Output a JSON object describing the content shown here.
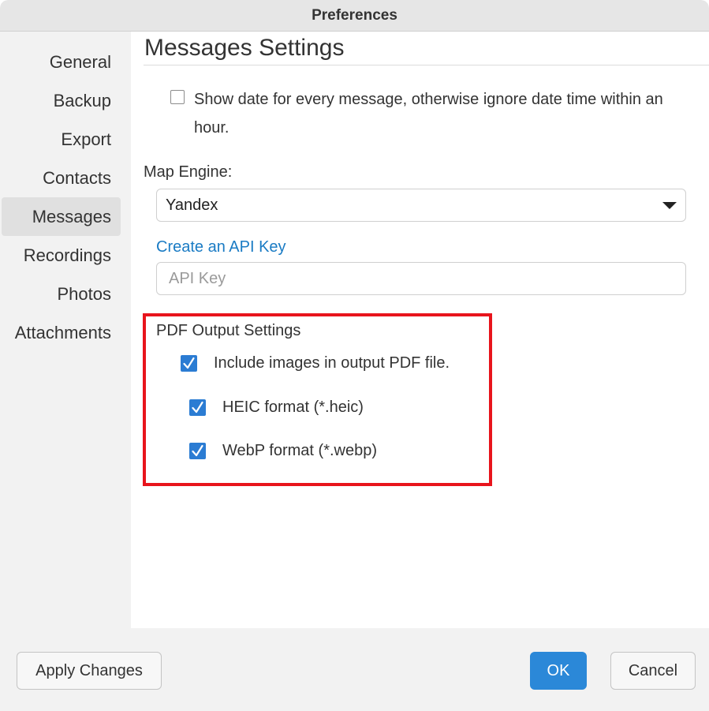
{
  "window": {
    "title": "Preferences"
  },
  "sidebar": {
    "items": [
      {
        "label": "General",
        "active": false
      },
      {
        "label": "Backup",
        "active": false
      },
      {
        "label": "Export",
        "active": false
      },
      {
        "label": "Contacts",
        "active": false
      },
      {
        "label": "Messages",
        "active": true
      },
      {
        "label": "Recordings",
        "active": false
      },
      {
        "label": "Photos",
        "active": false
      },
      {
        "label": "Attachments",
        "active": false
      }
    ]
  },
  "main": {
    "title": "Messages Settings",
    "show_date": {
      "label": "Show date for every message, otherwise ignore date time within an hour.",
      "checked": false
    },
    "map_engine": {
      "label": "Map Engine:",
      "selected": "Yandex"
    },
    "api_key": {
      "link_text": "Create an API Key",
      "placeholder": "API Key",
      "value": ""
    },
    "pdf": {
      "heading": "PDF Output Settings",
      "include_images": {
        "label": "Include images in output PDF file.",
        "checked": true
      },
      "heic": {
        "label": "HEIC format (*.heic)",
        "checked": true
      },
      "webp": {
        "label": "WebP format (*.webp)",
        "checked": true
      }
    }
  },
  "footer": {
    "apply_label": "Apply Changes",
    "ok_label": "OK",
    "cancel_label": "Cancel"
  },
  "colors": {
    "accent": "#2b88d8",
    "link": "#1a7bc4",
    "highlight": "#e8141c",
    "checkbox": "#2b7cd3"
  }
}
